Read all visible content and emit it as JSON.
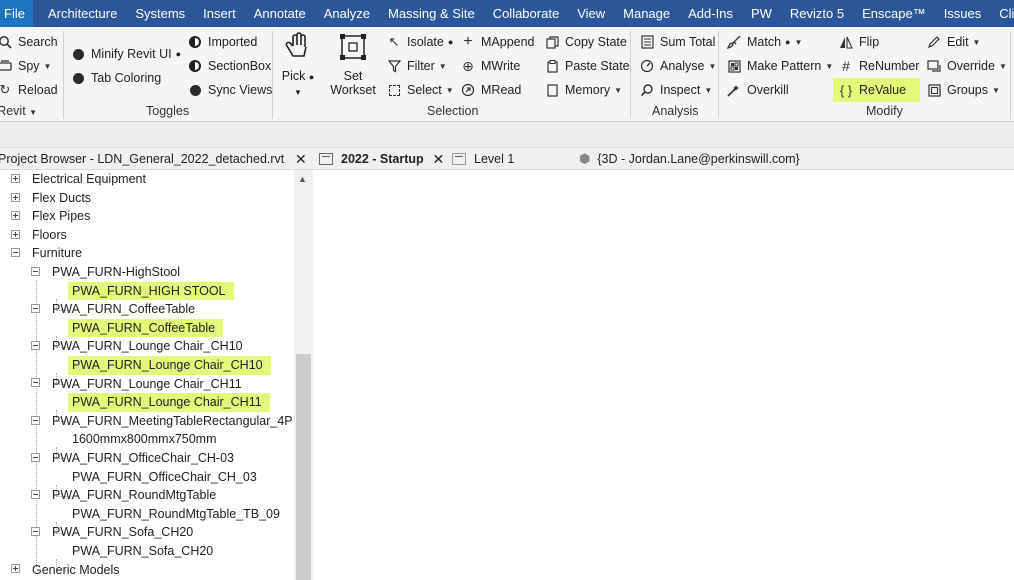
{
  "menu": [
    "File",
    "Architecture",
    "Systems",
    "Insert",
    "Annotate",
    "Analyze",
    "Massing & Site",
    "Collaborate",
    "View",
    "Manage",
    "Add-Ins",
    "PW",
    "Revizto 5",
    "Enscape™",
    "Issues",
    "ClimateStudio"
  ],
  "ribbon": {
    "pyrevit": {
      "label": "pyRevit",
      "buttons": [
        "Search",
        "Spy",
        "Reload"
      ]
    },
    "toggles": {
      "label": "Toggles",
      "buttons": [
        "Minify Revit UI",
        "Tab Coloring",
        "Imported",
        "SectionBox",
        "Sync Views"
      ]
    },
    "selection": {
      "label": "Selection",
      "pick": "Pick",
      "set_workset": "Set Workset",
      "buttons": [
        "Isolate",
        "Filter",
        "Select",
        "MAppend",
        "MWrite",
        "MRead",
        "Copy State",
        "Paste State",
        "Memory"
      ]
    },
    "analysis": {
      "label": "Analysis",
      "buttons": [
        "Sum Total",
        "Analyse",
        "Inspect"
      ]
    },
    "modify": {
      "label": "Modify",
      "buttons": [
        "Match",
        "Make Pattern",
        "Overkill",
        "Flip",
        "ReNumber",
        "ReValue",
        "Edit",
        "Override",
        "Groups"
      ]
    }
  },
  "browser": {
    "title": "Project Browser - LDN_General_2022_detached.rvt",
    "close": "✕",
    "items": [
      {
        "label": "Electrical Equipment"
      },
      {
        "label": "Flex Ducts"
      },
      {
        "label": "Flex Pipes"
      },
      {
        "label": "Floors"
      },
      {
        "label": "Furniture"
      },
      {
        "label": "PWA_FURN-HighStool"
      },
      {
        "label": "PWA_FURN_HIGH STOOL"
      },
      {
        "label": "PWA_FURN_CoffeeTable"
      },
      {
        "label": "PWA_FURN_CoffeeTable"
      },
      {
        "label": "PWA_FURN_Lounge Chair_CH10"
      },
      {
        "label": "PWA_FURN_Lounge Chair_CH10"
      },
      {
        "label": "PWA_FURN_Lounge Chair_CH11"
      },
      {
        "label": "PWA_FURN_Lounge Chair_CH11"
      },
      {
        "label": "PWA_FURN_MeetingTableRectangular_4P"
      },
      {
        "label": "1600mmx800mmx750mm"
      },
      {
        "label": "PWA_FURN_OfficeChair_CH-03"
      },
      {
        "label": "PWA_FURN_OfficeChair_CH_03"
      },
      {
        "label": "PWA_FURN_RoundMtgTable"
      },
      {
        "label": "PWA_FURN_RoundMtgTable_TB_09"
      },
      {
        "label": "PWA_FURN_Sofa_CH20"
      },
      {
        "label": "PWA_FURN_Sofa_CH20"
      },
      {
        "label": "Generic Models"
      }
    ]
  },
  "tabs": [
    {
      "label": "2022 - Startup",
      "close": "✕"
    },
    {
      "label": "Level 1"
    },
    {
      "label": "{3D - Jordan.Lane@perkinswill.com}"
    }
  ],
  "colors": {
    "menubar": "#2b579a",
    "highlight": "#e6f87a"
  }
}
